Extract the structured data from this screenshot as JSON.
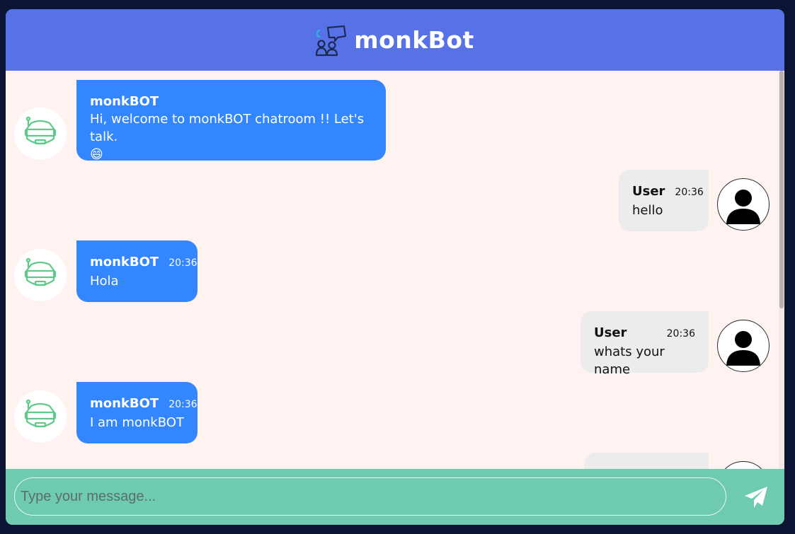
{
  "header": {
    "title": "monkBot",
    "logo_icon": "chat-robot-logo-icon"
  },
  "colors": {
    "header": "#5672e6",
    "bot_bubble": "#3486fe",
    "user_bubble": "#ececec",
    "footer": "#6ecbb0",
    "chat_bg": "#fff3f2"
  },
  "messages": [
    {
      "sender": "monkBOT",
      "time": "",
      "text": "Hi, welcome to monkBOT chatroom !! Let's talk.",
      "emoji": "😄"
    },
    {
      "sender": "User",
      "time": "20:36",
      "text": "hello"
    },
    {
      "sender": "monkBOT",
      "time": "20:36",
      "text": "Hola"
    },
    {
      "sender": "User",
      "time": "20:36",
      "text": "whats your name"
    },
    {
      "sender": "monkBOT",
      "time": "20:36",
      "text": "I am monkBOT"
    }
  ],
  "composer": {
    "placeholder": "Type your message...",
    "send_icon": "paper-plane-icon"
  }
}
